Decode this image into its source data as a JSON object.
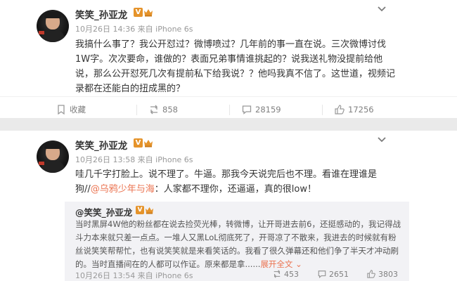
{
  "posts": [
    {
      "username": "笑笑_孙亚龙",
      "verified_badge": "V",
      "meta": "10月26日 14:36 来自 iPhone 6s",
      "content": "我搞什么事了？我公开怼过？微博喷过？几年前的事一直在说。三次微博讨伐1W字。次次要命，谁做的？表面兄弟事情谁挑起的？说我送礼物没提前给他说，那么公开怼死几次有提前私下给我说？？他吗我真不信了。这世道，视频记录都在还能白的扭成黑的？",
      "actions": {
        "favorite": "收藏",
        "repost": "858",
        "comment": "28159",
        "like": "17256"
      }
    },
    {
      "username": "笑笑_孙亚龙",
      "verified_badge": "V",
      "meta": "10月26日 13:58 来自 iPhone 6s",
      "content_before": "哇几千字打脸上。说不理了。牛逼。那我今天说完后也不理。看谁在理谁是狗//",
      "content_mention": "@乌鸦少年与海",
      "content_after": "：人家都不理你，还逼逼，真的很low！",
      "repost": {
        "username": "@笑笑_孙亚龙",
        "text": "当时黑屏4W他的粉丝都在说去捡荧光棒，转微博，让开哥进去前6，还挺感动的，我记得战斗力本来就只差一点点。一堆人又黑LoL彻底死了，开哥凉了不散来，我进去的时候就有粉丝说笑笑帮帮忙，也有说笑笑就是来看笑话的。我看了很久弹幕还和他们争了半天才冲动刷的。当时直播间在的人都可以作证。原来都是拿......",
        "expand": "展开全文",
        "meta": "10月26日 13:54 来自 iPhone 6s",
        "repost_count": "453",
        "comment_count": "2651",
        "like_count": "3803"
      }
    }
  ],
  "colors": {
    "accent": "#eb7350",
    "badge": "#e5932a",
    "meta": "#999999",
    "divider": "#eaeaea",
    "quote_bg": "#f2f2f5"
  },
  "icons": [
    "avatar",
    "verified-icon",
    "crown-icon",
    "chevron-down-icon",
    "favorite-icon",
    "repost-icon",
    "comment-icon",
    "like-icon"
  ]
}
